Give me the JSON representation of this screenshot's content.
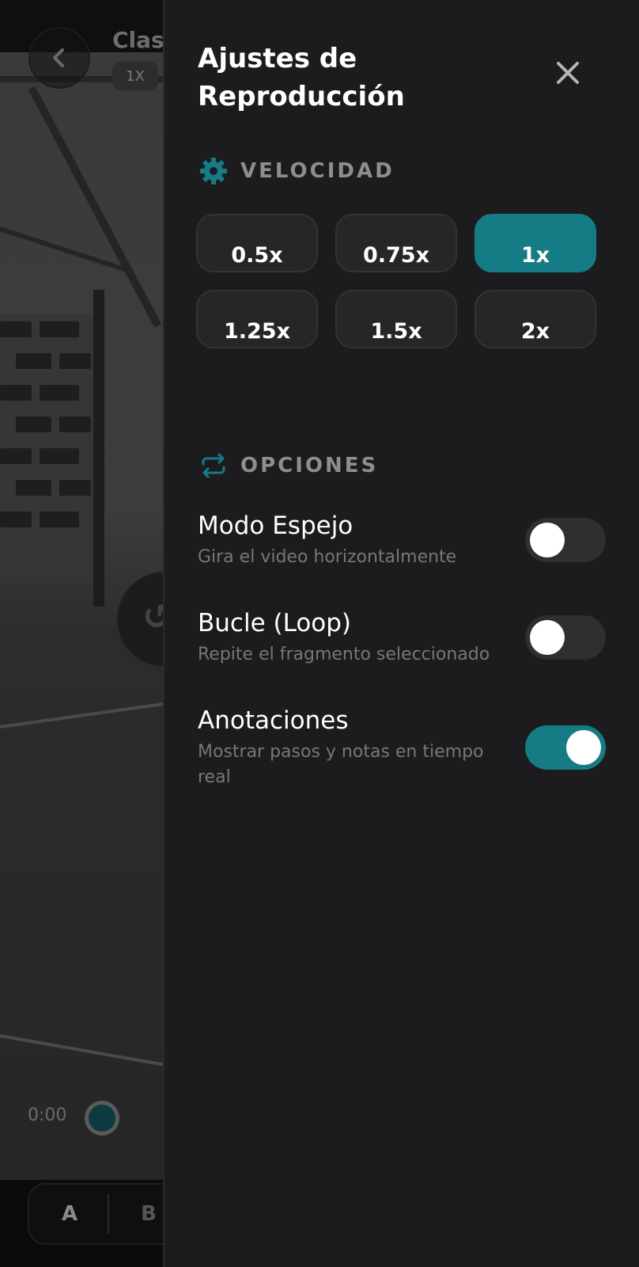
{
  "player": {
    "title": "Clas",
    "speed_chip": "1X",
    "current_time": "0:00",
    "ab_a": "A",
    "ab_b": "B"
  },
  "panel": {
    "title": "Ajustes de Reproducción",
    "speed_section": {
      "label": "VELOCIDAD",
      "icon": "gear-icon"
    },
    "speeds": [
      {
        "label": "0.5x",
        "active": false
      },
      {
        "label": "0.75x",
        "active": false
      },
      {
        "label": "1x",
        "active": true
      },
      {
        "label": "1.25x",
        "active": false
      },
      {
        "label": "1.5x",
        "active": false
      },
      {
        "label": "2x",
        "active": false
      }
    ],
    "options_section": {
      "label": "OPCIONES",
      "icon": "repeat-icon"
    },
    "options": [
      {
        "title": "Modo Espejo",
        "description": "Gira el video horizontalmente",
        "enabled": false
      },
      {
        "title": "Bucle (Loop)",
        "description": "Repite el fragmento seleccionado",
        "enabled": false
      },
      {
        "title": "Anotaciones",
        "description": "Mostrar pasos y notas en tiempo real",
        "enabled": true
      }
    ]
  },
  "colors": {
    "accent": "#157c85",
    "panel_bg": "#1c1c1e",
    "button_bg": "#262628",
    "muted_text": "#8e8e8e"
  }
}
